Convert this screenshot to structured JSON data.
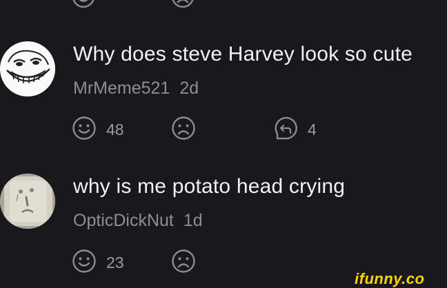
{
  "comments": [
    {
      "text": "Why does steve Harvey look so cute",
      "username": "MrMeme521",
      "time": "2d",
      "smile_count": "48",
      "reply_count": "4",
      "avatar_icon": "trollface-avatar"
    },
    {
      "text": "why is me potato head crying",
      "username": "OpticDickNut",
      "time": "1d",
      "smile_count": "23",
      "avatar_icon": "potato-head-avatar"
    }
  ],
  "watermark": "ifunny.co",
  "colors": {
    "background": "#19181d",
    "text": "#f2f2f4",
    "meta": "#8e8e96",
    "icon": "#8c8c94",
    "watermark": "#ffd400"
  }
}
